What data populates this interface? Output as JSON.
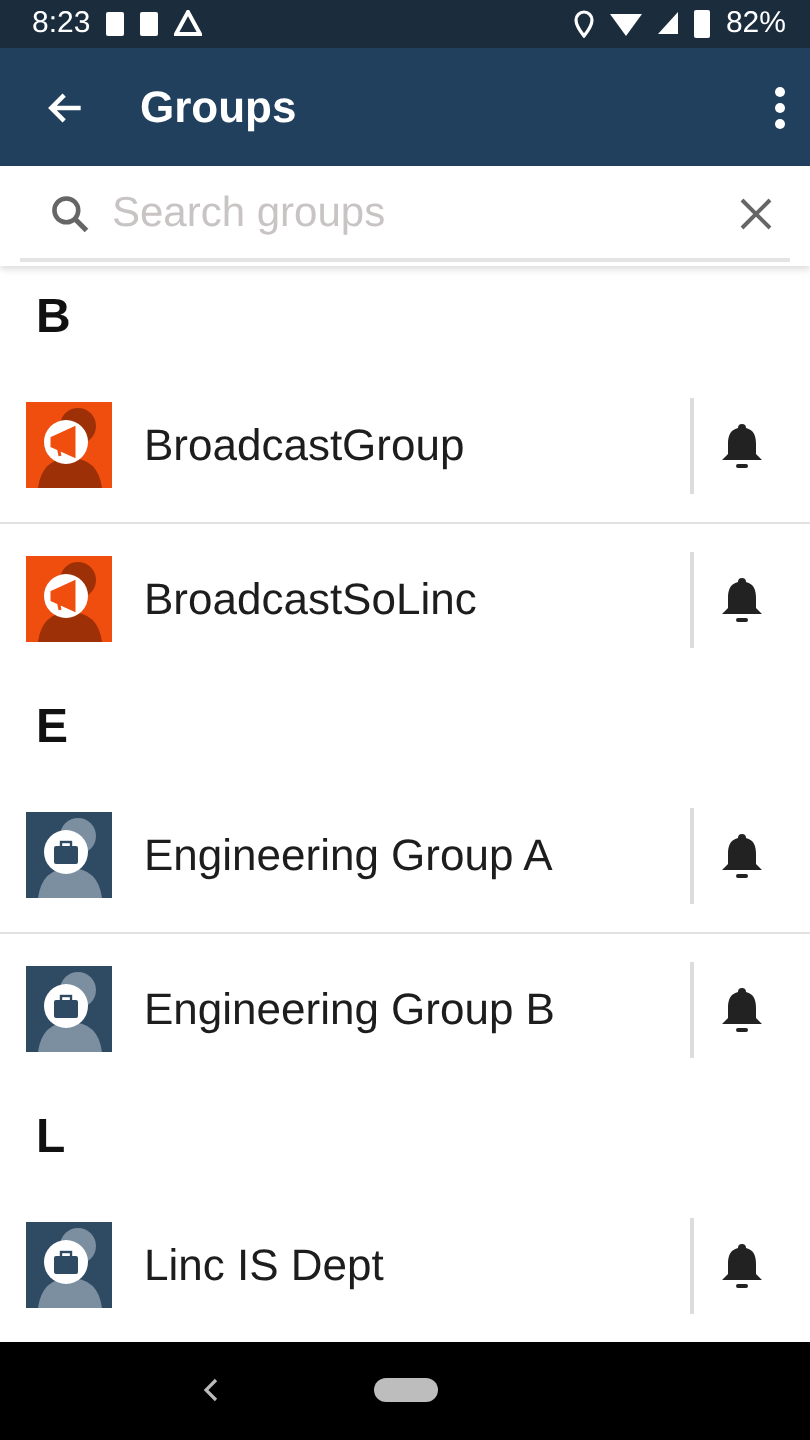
{
  "status_bar": {
    "time": "8:23",
    "battery": "82%"
  },
  "app_bar": {
    "title": "Groups"
  },
  "search": {
    "placeholder": "Search groups"
  },
  "sections": [
    {
      "letter": "B",
      "groups": [
        {
          "name": "BroadcastGroup",
          "kind": "broadcast"
        },
        {
          "name": "BroadcastSoLinc",
          "kind": "broadcast"
        }
      ]
    },
    {
      "letter": "E",
      "groups": [
        {
          "name": "Engineering Group A",
          "kind": "work"
        },
        {
          "name": "Engineering Group B",
          "kind": "work"
        }
      ]
    },
    {
      "letter": "L",
      "groups": [
        {
          "name": "Linc IS Dept",
          "kind": "work"
        }
      ]
    }
  ]
}
